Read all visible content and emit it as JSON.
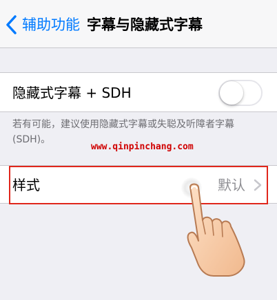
{
  "navbar": {
    "back_label": "辅助功能",
    "title": "字幕与隐藏式字幕",
    "icons": {
      "back": "chevron-left-icon"
    }
  },
  "closed_captions": {
    "label": "隐藏式字幕 + SDH",
    "toggle_on": false
  },
  "footnote": "若有可能，建议使用隐藏式字幕或失聪及听障者字幕 (SDH)。",
  "watermark": "www.qinpinchang.com",
  "style_row": {
    "label": "样式",
    "value": "默认",
    "icons": {
      "disclosure": "chevron-right-icon"
    }
  },
  "colors": {
    "accent": "#007aff",
    "highlight": "#e0261b",
    "background": "#efeff4",
    "secondary_text": "#8e8e93",
    "watermark": "#d00000"
  }
}
